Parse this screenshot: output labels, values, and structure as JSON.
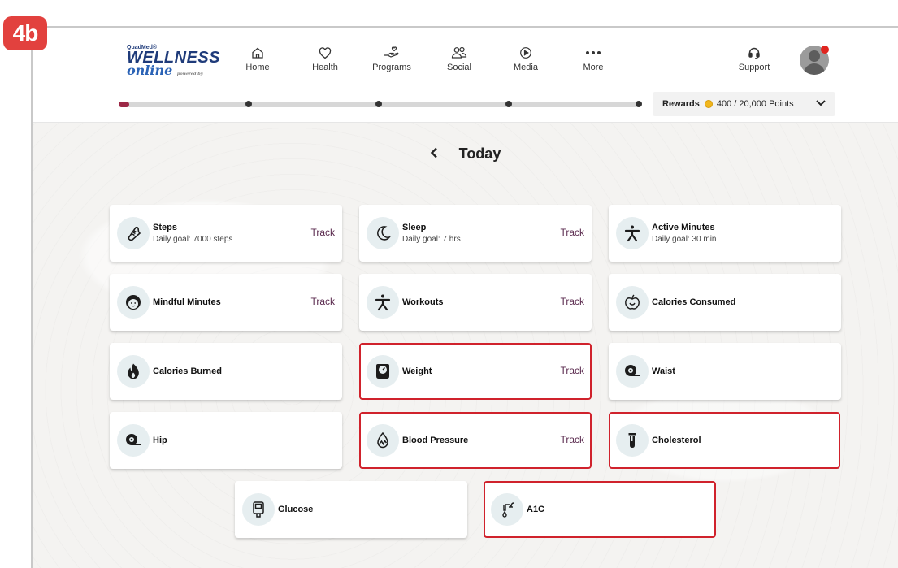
{
  "badge": "4b",
  "header": {
    "logo": {
      "brand_small": "QuadMed®",
      "brand_main": "WELLNESS",
      "brand_script": "online",
      "powered": "powered by"
    },
    "nav": [
      {
        "label": "Home",
        "icon": "home-icon"
      },
      {
        "label": "Health",
        "icon": "heart-icon"
      },
      {
        "label": "Programs",
        "icon": "hand-heart-icon"
      },
      {
        "label": "Social",
        "icon": "people-icon"
      },
      {
        "label": "Media",
        "icon": "play-icon"
      },
      {
        "label": "More",
        "icon": "more-dots-icon"
      }
    ],
    "support_label": "Support",
    "progress_fraction": 0.02,
    "rewards": {
      "label": "Rewards",
      "points": "400 / 20,000 Points"
    }
  },
  "main": {
    "title": "Today",
    "cards": [
      {
        "name": "Steps",
        "goal": "Daily goal: 7000 steps",
        "track": "Track",
        "icon": "shoe-icon"
      },
      {
        "name": "Sleep",
        "goal": "Daily goal: 7 hrs",
        "track": "Track",
        "icon": "moon-icon"
      },
      {
        "name": "Active Minutes",
        "goal": "Daily goal: 30 min",
        "track": "",
        "icon": "active-person-icon"
      },
      {
        "name": "Mindful Minutes",
        "goal": "",
        "track": "Track",
        "icon": "face-icon"
      },
      {
        "name": "Workouts",
        "goal": "",
        "track": "Track",
        "icon": "workout-person-icon"
      },
      {
        "name": "Calories Consumed",
        "goal": "",
        "track": "",
        "icon": "apple-icon"
      },
      {
        "name": "Calories Burned",
        "goal": "",
        "track": "",
        "icon": "flame-icon"
      },
      {
        "name": "Weight",
        "goal": "",
        "track": "Track",
        "icon": "scale-icon"
      },
      {
        "name": "Waist",
        "goal": "",
        "track": "",
        "icon": "tape-measure-icon"
      },
      {
        "name": "Hip",
        "goal": "",
        "track": "",
        "icon": "tape-measure-icon"
      },
      {
        "name": "Blood Pressure",
        "goal": "",
        "track": "Track",
        "icon": "blood-drop-icon"
      },
      {
        "name": "Cholesterol",
        "goal": "",
        "track": "",
        "icon": "test-tube-icon"
      },
      {
        "name": "Glucose",
        "goal": "",
        "track": "",
        "icon": "glucose-meter-icon"
      },
      {
        "name": "A1C",
        "goal": "",
        "track": "",
        "icon": "dropper-icon"
      }
    ]
  },
  "colors": {
    "badge": "#e2413e",
    "highlight": "#d0222c",
    "track": "#5b2b4f",
    "progress": "#9c2846",
    "icon_bg": "#e6eef0"
  }
}
